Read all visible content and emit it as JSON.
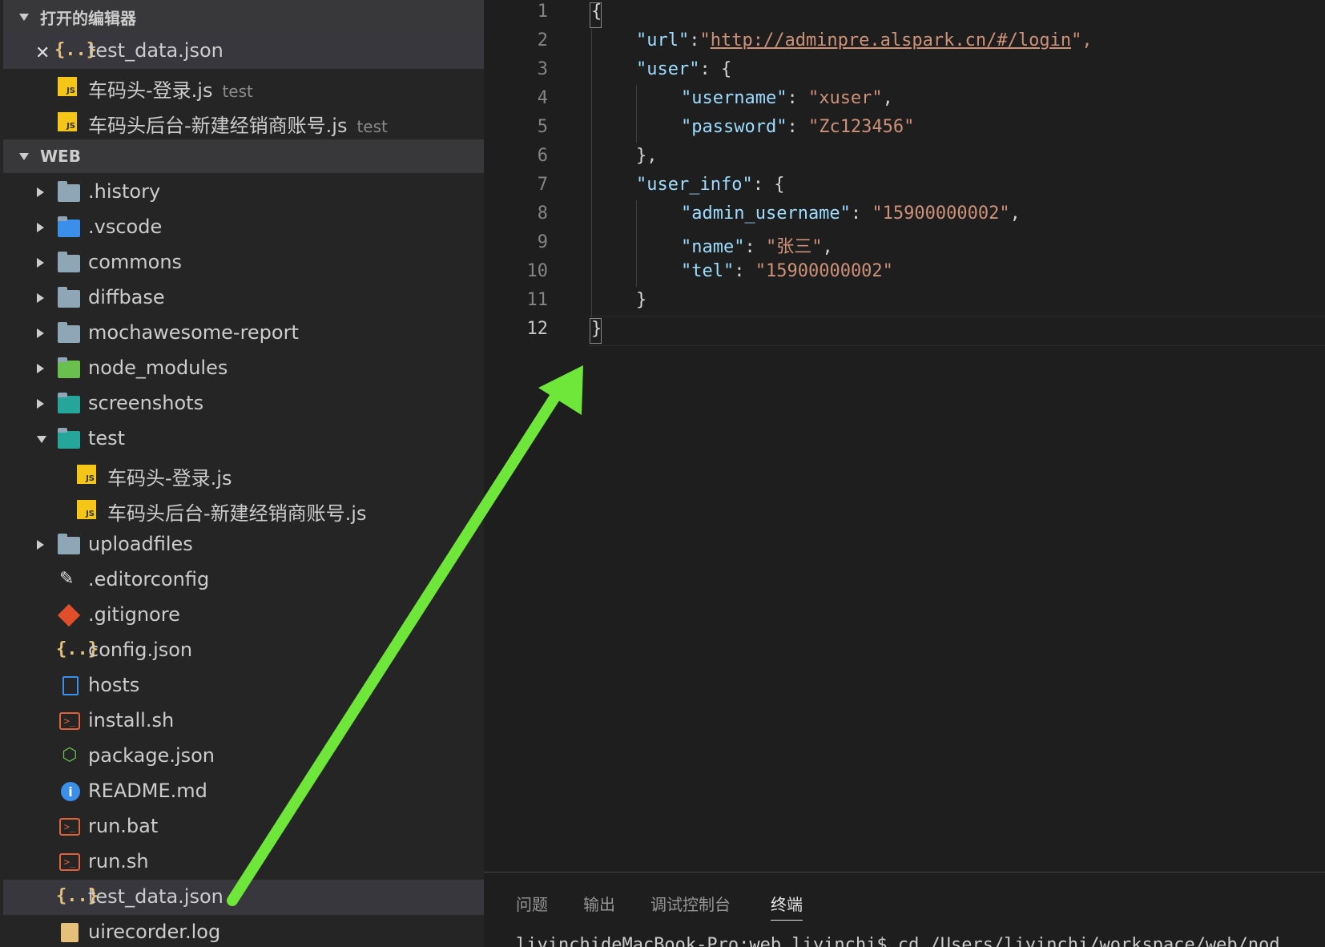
{
  "sidebar": {
    "open_editors_header": "打开的编辑器",
    "open_editors": [
      {
        "name": "test_data.json",
        "hint": ""
      },
      {
        "name": "车码头-登录.js",
        "hint": "test"
      },
      {
        "name": "车码头后台-新建经销商账号.js",
        "hint": "test"
      }
    ],
    "workspace_header": "WEB",
    "tree": [
      {
        "name": ".history"
      },
      {
        "name": ".vscode"
      },
      {
        "name": "commons"
      },
      {
        "name": "diffbase"
      },
      {
        "name": "mochawesome-report"
      },
      {
        "name": "node_modules"
      },
      {
        "name": "screenshots"
      },
      {
        "name": "test"
      },
      {
        "name": "车码头-登录.js"
      },
      {
        "name": "车码头后台-新建经销商账号.js"
      },
      {
        "name": "uploadfiles"
      },
      {
        "name": ".editorconfig"
      },
      {
        "name": ".gitignore"
      },
      {
        "name": "config.json"
      },
      {
        "name": "hosts"
      },
      {
        "name": "install.sh"
      },
      {
        "name": "package.json"
      },
      {
        "name": "README.md"
      },
      {
        "name": "run.bat"
      },
      {
        "name": "run.sh"
      },
      {
        "name": "test_data.json"
      },
      {
        "name": "uirecorder.log"
      }
    ]
  },
  "editor": {
    "line_numbers": [
      "1",
      "2",
      "3",
      "4",
      "5",
      "6",
      "7",
      "8",
      "9",
      "10",
      "11",
      "12"
    ],
    "lines": {
      "l1": "{",
      "l2_key": "\"url\"",
      "l2_colon": ":",
      "l2_q1": "\"",
      "l2_url": "http://adminpre.alspark.cn/#/login",
      "l2_q2": "\",",
      "l3_key": "\"user\"",
      "l3_rest": ": {",
      "l4_key": "\"username\"",
      "l4_colon": ": ",
      "l4_val": "\"xuser\"",
      "l4_comma": ",",
      "l5_key": "\"password\"",
      "l5_colon": ": ",
      "l5_val": "\"Zc123456\"",
      "l6": "},",
      "l7_key": "\"user_info\"",
      "l7_rest": ": {",
      "l8_key": "\"admin_username\"",
      "l8_colon": ": ",
      "l8_val": "\"15900000002\"",
      "l8_comma": ",",
      "l9_key": "\"name\"",
      "l9_colon": ": ",
      "l9_val": "\"张三\"",
      "l9_comma": ",",
      "l10_key": "\"tel\"",
      "l10_colon": ": ",
      "l10_val": "\"15900000002\"",
      "l11": "}",
      "l12": "}"
    }
  },
  "panel": {
    "tabs": [
      "问题",
      "输出",
      "调试控制台",
      "终端"
    ],
    "terminal_text": "liyinchideMacBook-Pro:web liyinchi$ cd /Users/liyinchi/workspace/web/nod"
  },
  "colors": {
    "accent_arrow": "#6fe63a",
    "sidebar_bg": "#252526",
    "editor_bg": "#1e1e1e"
  }
}
